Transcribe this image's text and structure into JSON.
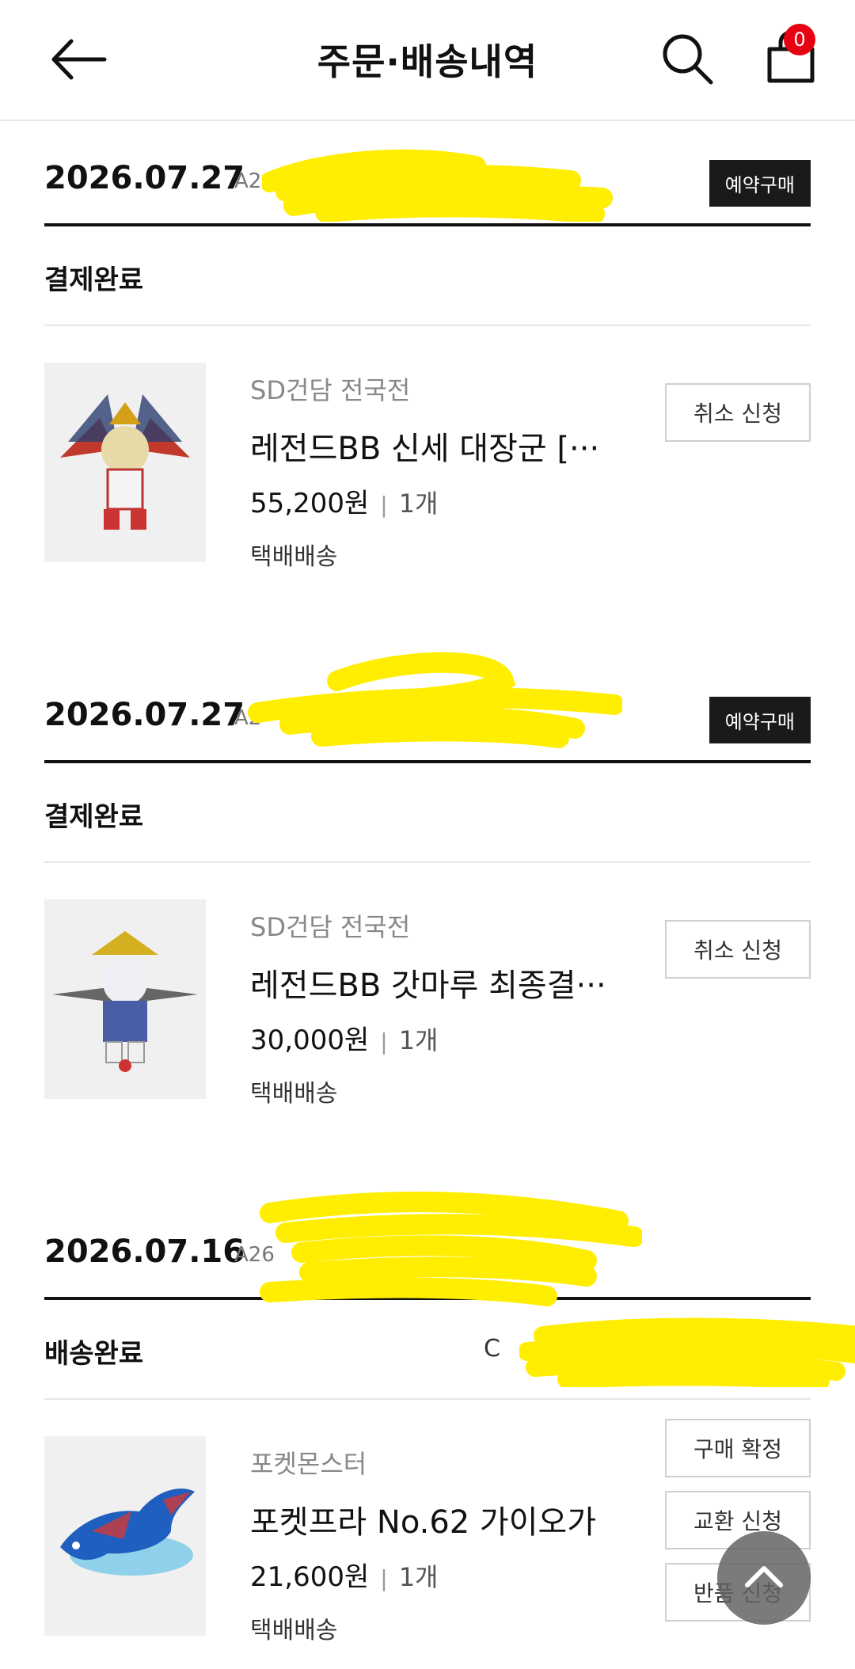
{
  "header": {
    "title": "주문·배송내역",
    "cart_count": "0"
  },
  "orders": [
    {
      "date": "2026.07.27",
      "order_no_visible": "A26",
      "tag": "예약구매",
      "status": "결제완료",
      "carrier": "",
      "product": {
        "brand": "SD건담 전국전",
        "name": "레전드BB 신세 대장군 [···",
        "price": "55,200원",
        "qty": "1개",
        "shipping": "택배배송"
      },
      "buttons": [
        "취소 신청"
      ]
    },
    {
      "date": "2026.07.27",
      "order_no_visible": "A2",
      "tag": "예약구매",
      "status": "결제완료",
      "carrier": "",
      "product": {
        "brand": "SD건담 전국전",
        "name": "레전드BB 갓마루 최종결···",
        "price": "30,000원",
        "qty": "1개",
        "shipping": "택배배송"
      },
      "buttons": [
        "취소 신청"
      ]
    },
    {
      "date": "2026.07.16",
      "order_no_visible": "A26",
      "tag": "",
      "status": "배송완료",
      "carrier": "C",
      "product": {
        "brand": "포켓몬스터",
        "name": "포켓프라 No.62 가이오가",
        "price": "21,600원",
        "qty": "1개",
        "shipping": "택배배송"
      },
      "buttons": [
        "구매 확정",
        "교환 신청",
        "반품 신청"
      ]
    }
  ],
  "colors": {
    "badge_red": "#e60012",
    "tag_bg": "#1a1a1a",
    "redaction_yellow": "#ffee00"
  },
  "icons": [
    "back-arrow-icon",
    "search-icon",
    "shopping-bag-icon",
    "chevron-up-icon"
  ]
}
